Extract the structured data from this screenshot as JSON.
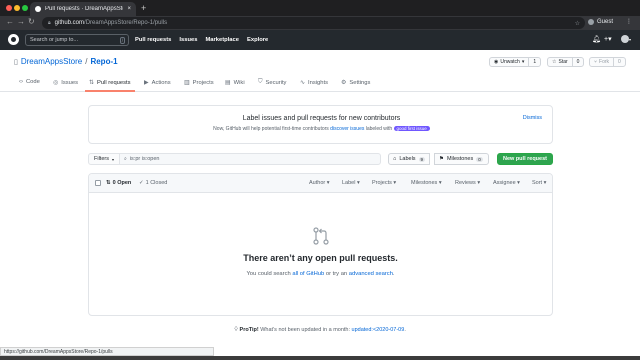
{
  "browser": {
    "tab_title": "Pull requests · DreamAppsStore...",
    "tab_close": "×",
    "new_tab": "+",
    "url_host": "github.com",
    "url_path": "/DreamAppsStore/Repo-1/pulls",
    "profile": "Guest",
    "menu": "⋮",
    "status_url": "https://github.com/DreamAppsStore/Repo-1/pulls"
  },
  "header": {
    "search_placeholder": "Search or jump to...",
    "search_key": "/",
    "nav": [
      "Pull requests",
      "Issues",
      "Marketplace",
      "Explore"
    ]
  },
  "repo": {
    "owner": "DreamAppsStore",
    "separator": "/",
    "name": "Repo-1",
    "unwatch_label": "Unwatch",
    "unwatch_count": "1",
    "star_label": "Star",
    "star_count": "0",
    "fork_label": "Fork",
    "fork_count": "0"
  },
  "tabs": [
    {
      "label": "Code",
      "icon": "code-icon"
    },
    {
      "label": "Issues",
      "icon": "issue-icon"
    },
    {
      "label": "Pull requests",
      "icon": "pull-request-icon"
    },
    {
      "label": "Actions",
      "icon": "play-icon"
    },
    {
      "label": "Projects",
      "icon": "project-icon"
    },
    {
      "label": "Wiki",
      "icon": "book-icon"
    },
    {
      "label": "Security",
      "icon": "shield-icon"
    },
    {
      "label": "Insights",
      "icon": "graph-icon"
    },
    {
      "label": "Settings",
      "icon": "gear-icon"
    }
  ],
  "banner": {
    "title": "Label issues and pull requests for new contributors",
    "text_before": "Now, GitHub will help potential first-time contributors",
    "link": "discover issues",
    "text_middle": "labeled with",
    "badge": "good first issue",
    "dismiss": "Dismiss"
  },
  "filters": {
    "button": "Filters",
    "query": "is:pr is:open",
    "labels_label": "Labels",
    "labels_count": "9",
    "milestones_label": "Milestones",
    "milestones_count": "0",
    "new_pr": "New pull request"
  },
  "list": {
    "open": "0 Open",
    "closed": "1 Closed",
    "filters": [
      "Author",
      "Label",
      "Projects",
      "Milestones",
      "Reviews",
      "Assignee",
      "Sort"
    ],
    "empty_title": "There aren’t any open pull requests.",
    "empty_text_before": "You could search",
    "empty_link1": "all of GitHub",
    "empty_text_middle": "or try an",
    "empty_link2": "advanced search",
    "empty_text_after": "."
  },
  "protip": {
    "bold": "ProTip!",
    "text": "What’s not been updated in a month:",
    "link": "updated:<2020-07-09",
    "end": "."
  },
  "colors": {
    "header_bg": "#24292e",
    "link": "#0366d6",
    "green": "#2ea44f",
    "tab_underline": "#f9826c",
    "badge": "#7057ff"
  }
}
